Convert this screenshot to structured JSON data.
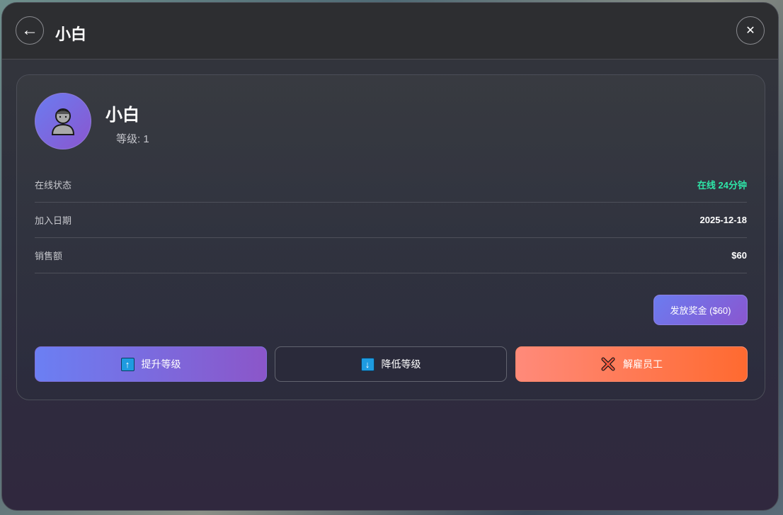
{
  "header": {
    "back_icon": "←",
    "title": "小白",
    "close_icon": "✕"
  },
  "profile": {
    "avatar_icon": "person-icon",
    "name": "小白",
    "level_text": "等级: 1"
  },
  "details": [
    {
      "label": "在线状态",
      "value": "在线 24分钟",
      "value_color": "#2ee6a8"
    },
    {
      "label": "加入日期",
      "value": "2025-12-18"
    },
    {
      "label": "销售额",
      "value": "$60"
    }
  ],
  "bonus_button": "发放奖金 ($60)",
  "actions": {
    "promote": {
      "icon": "↑",
      "label": "提升等级"
    },
    "demote": {
      "icon": "↓",
      "label": "降低等级"
    },
    "fire": {
      "icon": "cross-mark-icon",
      "label": "解雇员工"
    }
  },
  "colors": {
    "accent_gradient_start": "#6b7cf0",
    "accent_gradient_end": "#8a56cf",
    "danger_gradient_start": "#ff8a7a",
    "danger_gradient_end": "#ff6a30",
    "online_green": "#2ee6a8"
  }
}
